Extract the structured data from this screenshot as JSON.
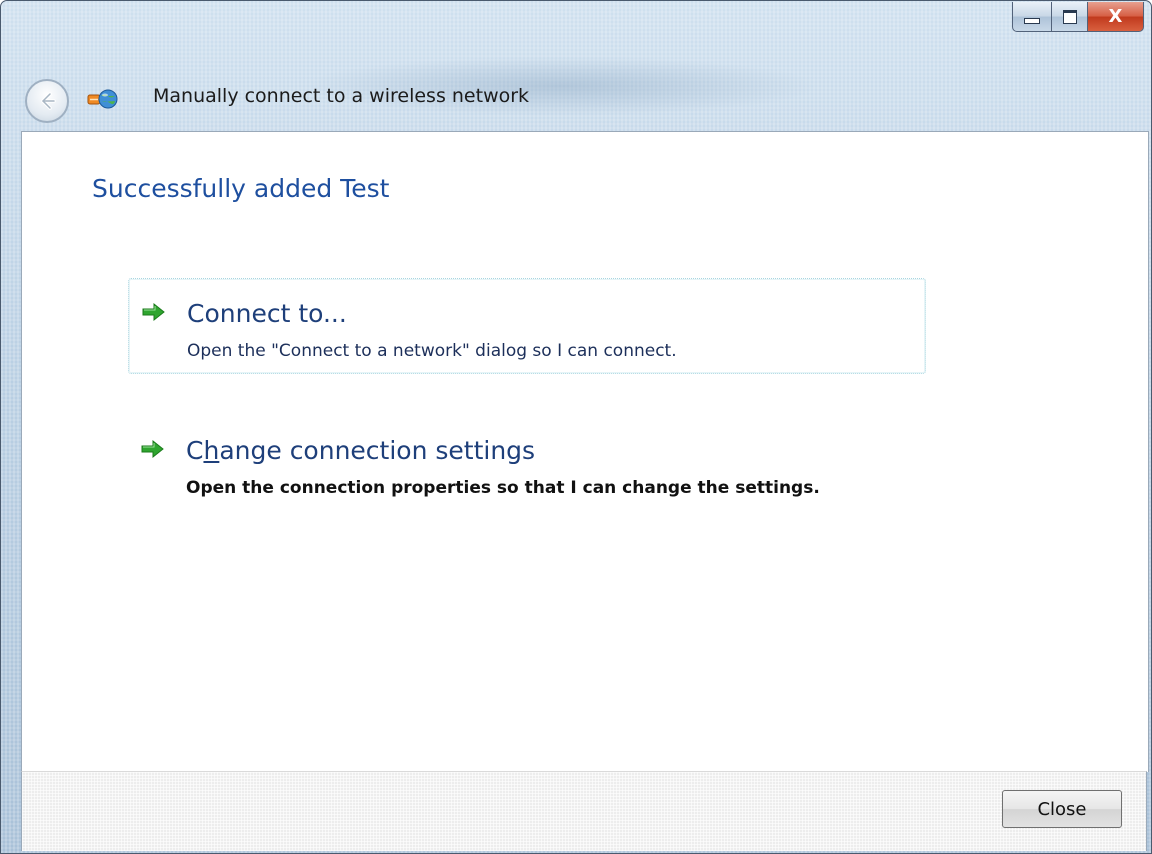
{
  "window": {
    "title": "Manually connect to a wireless network",
    "caption_buttons": {
      "minimize_icon": "minimize-icon",
      "maximize_icon": "maximize-icon",
      "close_label": "X"
    }
  },
  "nav": {
    "back_icon": "back-arrow-icon",
    "app_icon": "network-globe-icon"
  },
  "main": {
    "heading": "Successfully added Test",
    "options": [
      {
        "title": "Connect to...",
        "description": "Open the \"Connect to a network\" dialog so I can connect.",
        "icon": "green-arrow-icon"
      },
      {
        "title_before": "C",
        "title_underlined": "h",
        "title_after": "ange connection settings",
        "description": "Open the connection properties so that I can change the settings.",
        "icon": "green-arrow-icon"
      }
    ]
  },
  "footer": {
    "close_label": "Close"
  },
  "colors": {
    "heading": "#1e4f9f",
    "link_title": "#1e3f7a",
    "arrow_green": "#2fa52f",
    "close_button_red": "#c0391d"
  }
}
